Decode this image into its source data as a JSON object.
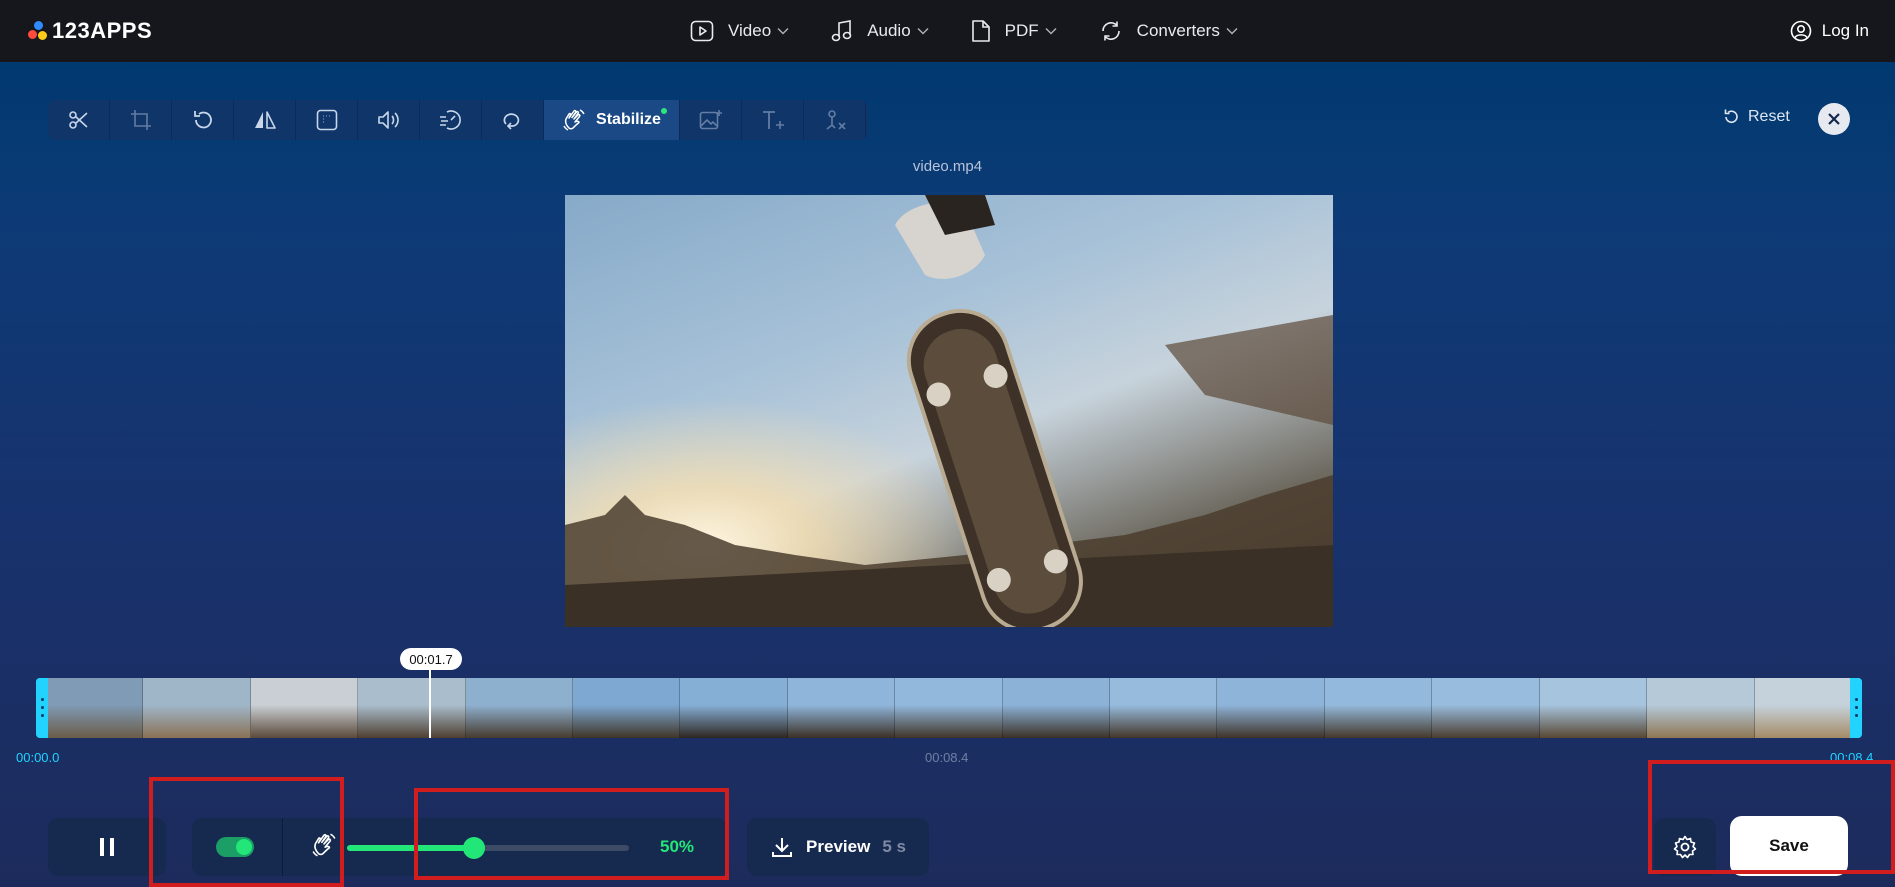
{
  "brand": {
    "name": "123APPS"
  },
  "nav": {
    "items": [
      {
        "label": "Video",
        "icon": "video-play-icon"
      },
      {
        "label": "Audio",
        "icon": "music-note-icon"
      },
      {
        "label": "PDF",
        "icon": "document-icon"
      },
      {
        "label": "Converters",
        "icon": "convert-cycle-icon"
      }
    ],
    "login_label": "Log In"
  },
  "toolbar": {
    "tools": [
      {
        "name": "cut",
        "icon": "scissors-icon"
      },
      {
        "name": "crop",
        "icon": "crop-icon"
      },
      {
        "name": "rotate",
        "icon": "rotate-icon"
      },
      {
        "name": "flip",
        "icon": "flip-icon"
      },
      {
        "name": "resize",
        "icon": "resize-icon"
      },
      {
        "name": "volume",
        "icon": "volume-icon"
      },
      {
        "name": "speed",
        "icon": "speed-icon"
      },
      {
        "name": "loop",
        "icon": "loop-icon"
      }
    ],
    "active_label": "Stabilize",
    "reset_label": "Reset"
  },
  "video": {
    "filename": "video.mp4"
  },
  "timeline": {
    "current_time": "00:01.7",
    "start_time": "00:00.0",
    "mid_time": "00:08.4",
    "end_time": "00:08.4",
    "frame_count": 17,
    "playhead_fraction": 0.2
  },
  "controls": {
    "stabilize_enabled": true,
    "strength_value": 50,
    "strength_label": "50%",
    "preview_label": "Preview",
    "preview_seconds": "5 s",
    "save_label": "Save"
  },
  "colors": {
    "accent_green": "#22e677",
    "timeline_handle": "#22d3ff",
    "annotation_red": "#d11d1d",
    "topbar": "#15171c"
  }
}
